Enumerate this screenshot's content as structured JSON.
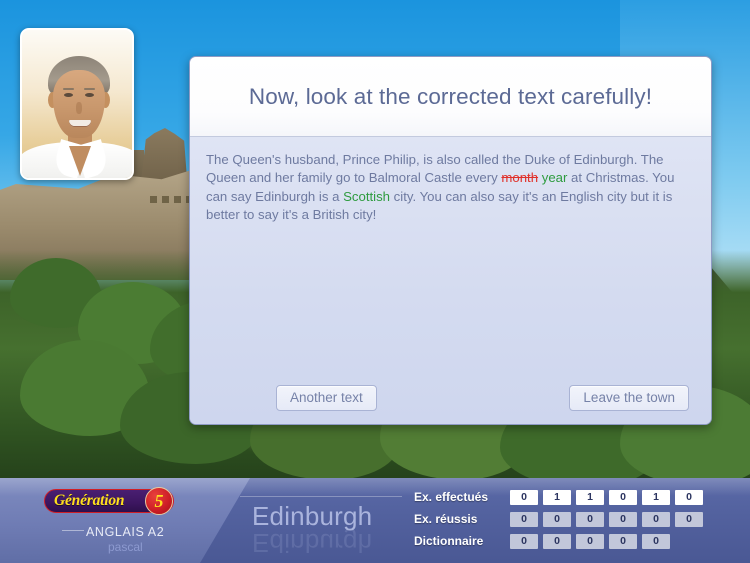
{
  "app": {
    "logo_word": "Génération",
    "logo_badge": "5",
    "course": "ANGLAIS A2",
    "user": "pascal",
    "city": "Edinburgh"
  },
  "panel": {
    "title": "Now, look at the corrected text carefully!",
    "text_segments": [
      {
        "text": "The Queen's husband, Prince Philip, is also called the Duke of Edinburgh. The Queen and her family go to Balmoral Castle every ",
        "style": "normal"
      },
      {
        "text": "month",
        "style": "deleted"
      },
      {
        "text": " ",
        "style": "normal"
      },
      {
        "text": "year",
        "style": "corrected"
      },
      {
        "text": " at Christmas. You can say Edinburgh is a ",
        "style": "normal"
      },
      {
        "text": "Scottish",
        "style": "corrected"
      },
      {
        "text": " city. You can also say it's an English city but it is better to say it's a British city!",
        "style": "normal"
      }
    ],
    "buttons": {
      "another_text": "Another text",
      "leave_town": "Leave the town"
    }
  },
  "footer_stats": {
    "rows": [
      {
        "label": "Ex. effectués",
        "style": "white",
        "values": [
          "0",
          "1",
          "1",
          "0",
          "1",
          "0"
        ]
      },
      {
        "label": "Ex. réussis",
        "style": "gray",
        "values": [
          "0",
          "0",
          "0",
          "0",
          "0",
          "0"
        ]
      },
      {
        "label": "Dictionnaire",
        "style": "gray",
        "values": [
          "0",
          "0",
          "0",
          "0",
          "0"
        ]
      }
    ]
  },
  "colors": {
    "deleted": "#e0302a",
    "corrected": "#2e9b3f",
    "panel_title": "#5c6a95",
    "body_text": "#6e7aa0",
    "footer": "#53629f"
  }
}
